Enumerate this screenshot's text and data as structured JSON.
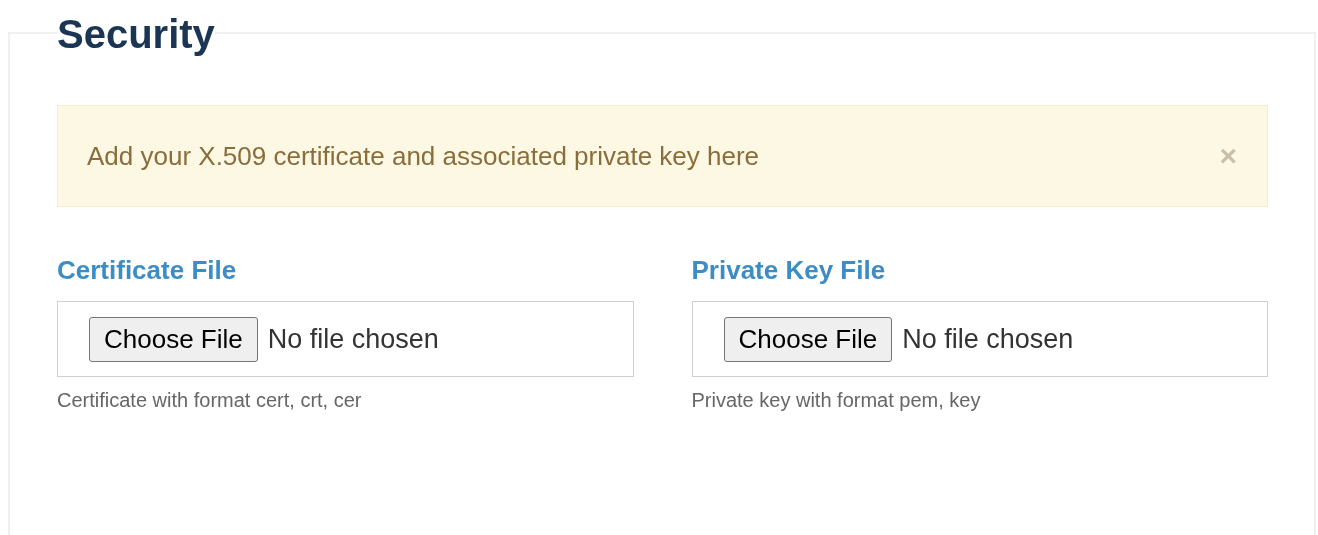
{
  "title": "Security",
  "alert": {
    "message": "Add your X.509 certificate and associated private key here",
    "close": "×"
  },
  "fields": [
    {
      "label": "Certificate File",
      "button": "Choose File",
      "status": "No file chosen",
      "help": "Certificate with format cert, crt, cer"
    },
    {
      "label": "Private Key File",
      "button": "Choose File",
      "status": "No file chosen",
      "help": "Private key with format pem, key"
    }
  ]
}
